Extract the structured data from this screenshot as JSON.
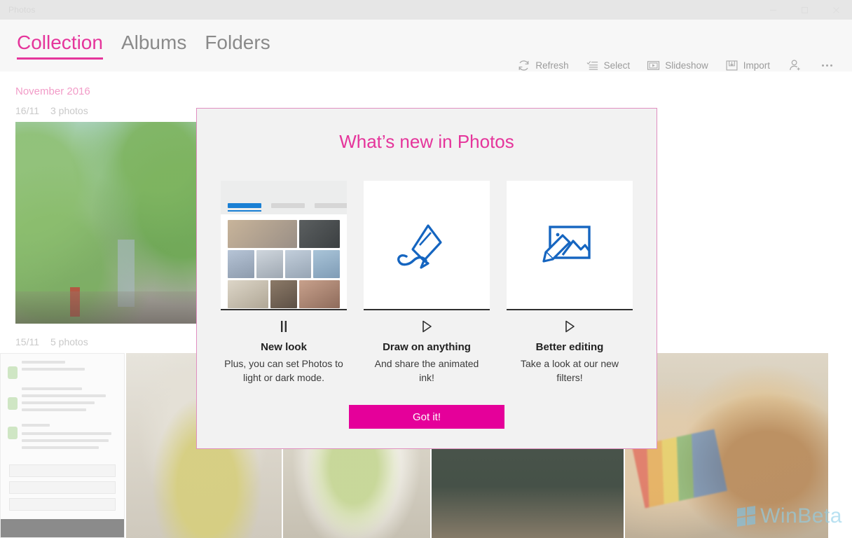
{
  "window": {
    "title": "Photos",
    "controls": {
      "minimize": "minimize",
      "maximize": "restore",
      "close": "close"
    }
  },
  "nav": {
    "tabs": [
      {
        "label": "Collection",
        "active": true
      },
      {
        "label": "Albums",
        "active": false
      },
      {
        "label": "Folders",
        "active": false
      }
    ]
  },
  "toolbar": {
    "items": [
      {
        "label": "Refresh",
        "icon": "refresh-icon"
      },
      {
        "label": "Select",
        "icon": "select-icon"
      },
      {
        "label": "Slideshow",
        "icon": "slideshow-icon"
      },
      {
        "label": "Import",
        "icon": "import-icon"
      }
    ],
    "account_icon": "person-add-icon",
    "overflow_icon": "more-options-icon"
  },
  "collection": {
    "month": "November 2016",
    "groups": [
      {
        "date": "16/11",
        "count": "3 photos"
      },
      {
        "date": "15/11",
        "count": "5 photos"
      }
    ]
  },
  "watermark": {
    "text": "WinBeta",
    "logo": "windows-logo-icon"
  },
  "dialog": {
    "title": "What’s new in Photos",
    "cards": [
      {
        "title": "New look",
        "desc": "Plus, you can set Photos to light or dark mode.",
        "control": "pause-icon",
        "media": "photo-grid-mockup"
      },
      {
        "title": "Draw on anything",
        "desc": "And share the animated ink!",
        "control": "play-icon",
        "media": "pen-ink-icon"
      },
      {
        "title": "Better editing",
        "desc": "Take a look at our new filters!",
        "control": "play-icon",
        "media": "photo-edit-icon"
      }
    ],
    "confirm_label": "Got it!",
    "accent_color": "#e5009a",
    "border_color": "#e08fc0",
    "title_color": "#e5359b"
  }
}
